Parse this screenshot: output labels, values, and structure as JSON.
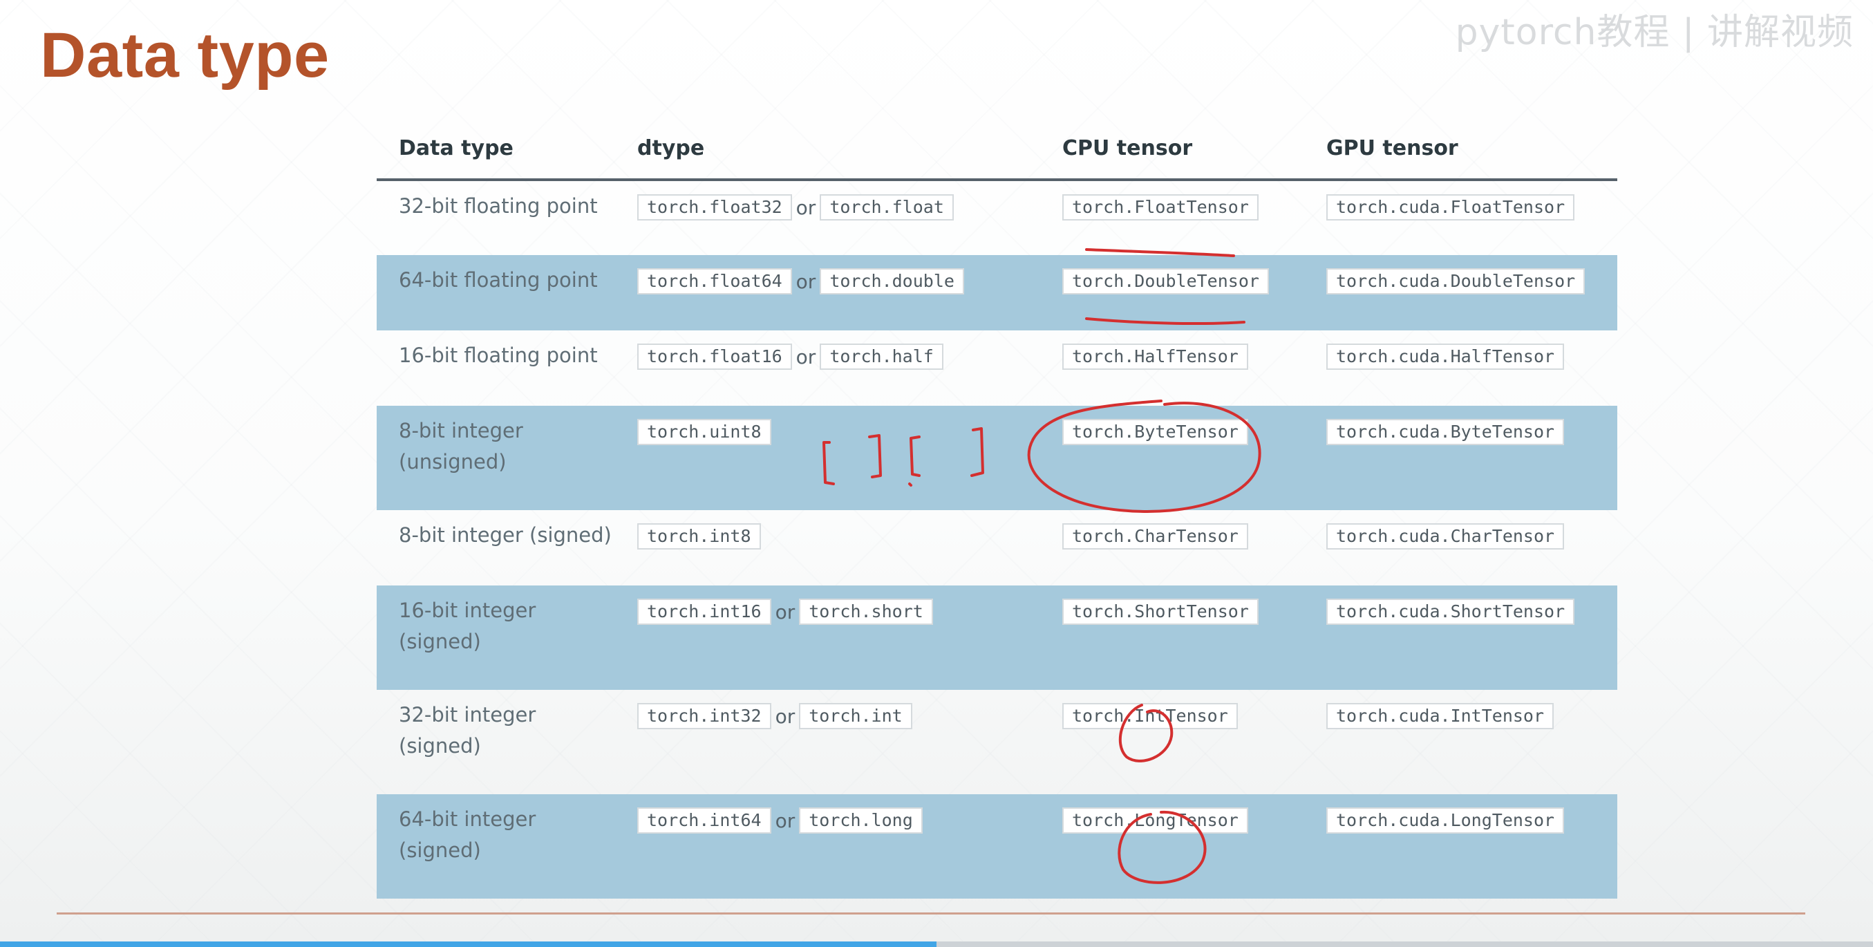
{
  "slide": {
    "title": "Data type",
    "watermark": "pytorch教程 | 讲解视频",
    "accent_color": "#b4532a",
    "row_shade_color": "#a5c9dc",
    "annotation_color": "#d42f2f",
    "video_progress": 0.5
  },
  "table": {
    "headers": [
      "Data type",
      "dtype",
      "CPU tensor",
      "GPU tensor"
    ],
    "or_word": "or",
    "rows": [
      {
        "label": "32-bit floating point",
        "dtypes": [
          "torch.float32",
          "torch.float"
        ],
        "cpu": "torch.FloatTensor",
        "gpu": "torch.cuda.FloatTensor"
      },
      {
        "label": "64-bit floating point",
        "dtypes": [
          "torch.float64",
          "torch.double"
        ],
        "cpu": "torch.DoubleTensor",
        "gpu": "torch.cuda.DoubleTensor"
      },
      {
        "label": "16-bit floating point",
        "dtypes": [
          "torch.float16",
          "torch.half"
        ],
        "cpu": "torch.HalfTensor",
        "gpu": "torch.cuda.HalfTensor"
      },
      {
        "label": "8-bit integer (unsigned)",
        "dtypes": [
          "torch.uint8"
        ],
        "cpu": "torch.ByteTensor",
        "gpu": "torch.cuda.ByteTensor"
      },
      {
        "label": "8-bit integer (signed)",
        "dtypes": [
          "torch.int8"
        ],
        "cpu": "torch.CharTensor",
        "gpu": "torch.cuda.CharTensor"
      },
      {
        "label": "16-bit integer (signed)",
        "dtypes": [
          "torch.int16",
          "torch.short"
        ],
        "cpu": "torch.ShortTensor",
        "gpu": "torch.cuda.ShortTensor"
      },
      {
        "label": "32-bit integer (signed)",
        "dtypes": [
          "torch.int32",
          "torch.int"
        ],
        "cpu": "torch.IntTensor",
        "gpu": "torch.cuda.IntTensor"
      },
      {
        "label": "64-bit integer (signed)",
        "dtypes": [
          "torch.int64",
          "torch.long"
        ],
        "cpu": "torch.LongTensor",
        "gpu": "torch.cuda.LongTensor"
      }
    ]
  }
}
